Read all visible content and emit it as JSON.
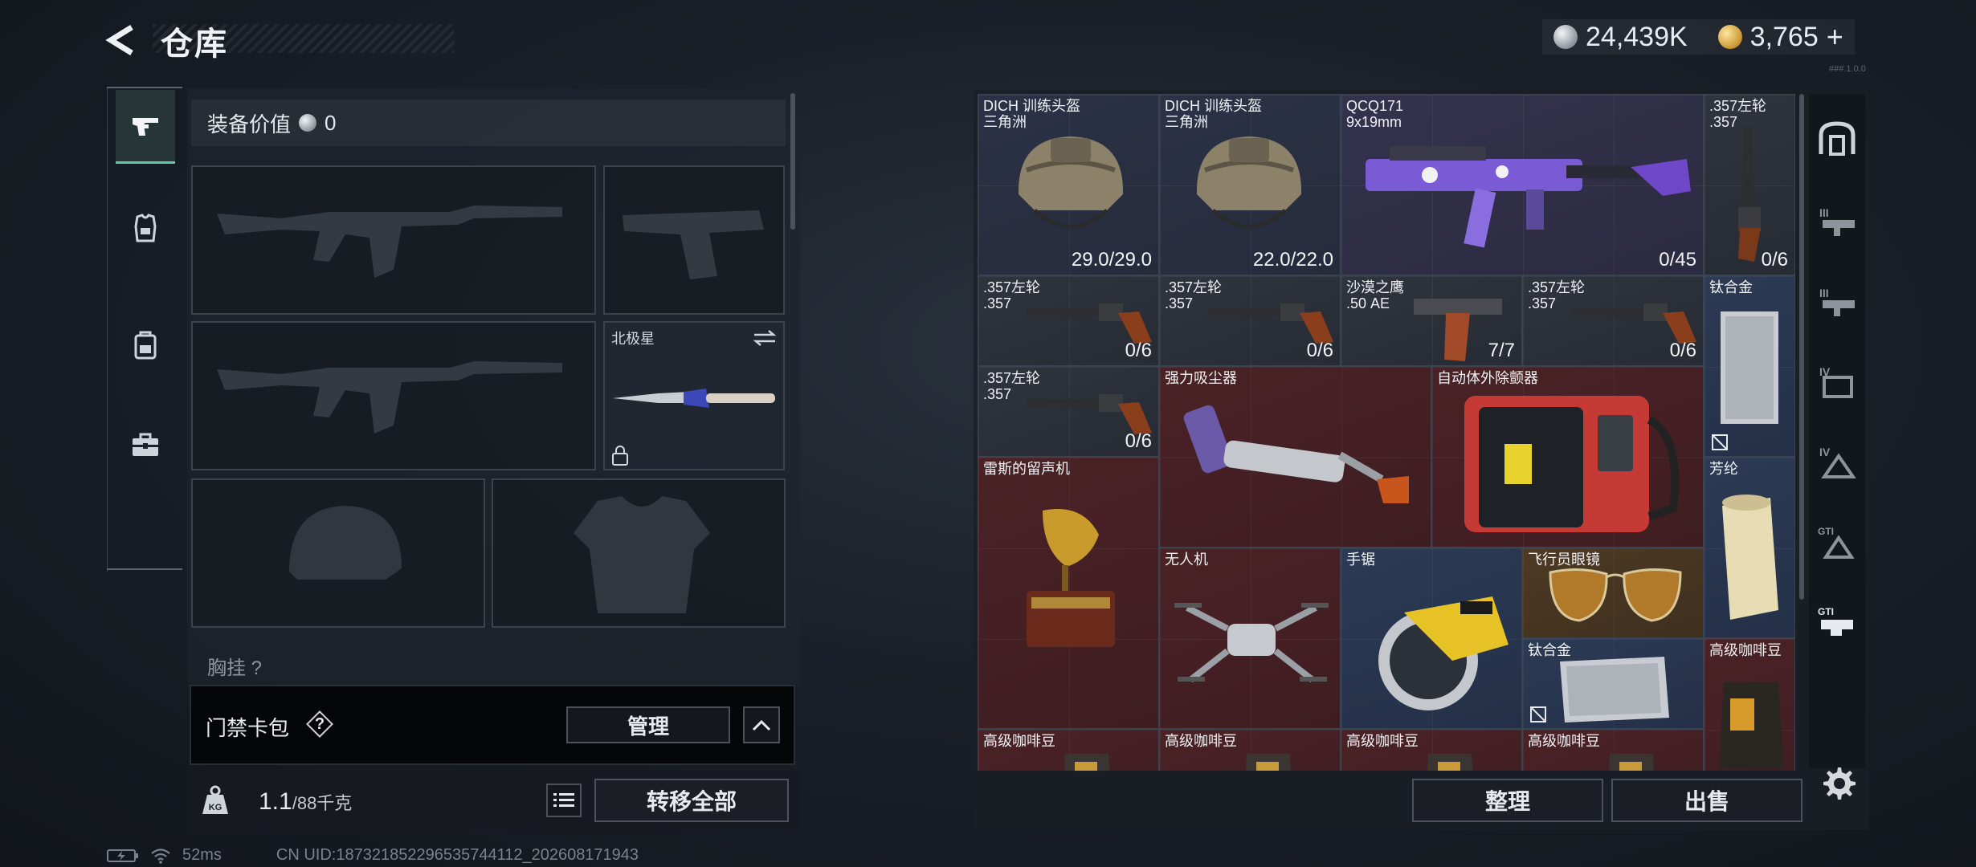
{
  "header": {
    "title": "仓库",
    "currency_a": "24,439K",
    "currency_b": "3,765",
    "currency_b_suffix": "+",
    "version": "###.1.0.0"
  },
  "loadout": {
    "value_label": "装备价值",
    "value": "0",
    "melee_label": "北极星",
    "chest_label": "胸挂",
    "chest_hint": "?",
    "card_bag_label": "门禁卡包",
    "card_bag_help": "?",
    "manage_label": "管理",
    "weight_current": "1.1",
    "weight_max": "/88千克",
    "transfer_label": "转移全部"
  },
  "storage": {
    "items": [
      {
        "name": "DICH 训练头盔\n三角洲",
        "count": "29.0/29.0",
        "tone": "b"
      },
      {
        "name": "DICH 训练头盔\n三角洲",
        "count": "22.0/22.0",
        "tone": "b"
      },
      {
        "name": "QCQ171\n9x19mm",
        "count": "0/45",
        "tone": "p"
      },
      {
        "name": ".357左轮\n.357",
        "count": "0/6",
        "tone": "g"
      },
      {
        "name": ".357左轮\n.357",
        "count": "0/6",
        "tone": "g"
      },
      {
        "name": ".357左轮\n.357",
        "count": "0/6",
        "tone": "g"
      },
      {
        "name": "沙漠之鹰\n.50 AE",
        "count": "7/7",
        "tone": "g"
      },
      {
        "name": ".357左轮\n.357",
        "count": "0/6",
        "tone": "g"
      },
      {
        "name": "钛合金",
        "count": "",
        "tone": "s"
      },
      {
        "name": ".357左轮\n.357",
        "count": "0/6",
        "tone": "g"
      },
      {
        "name": "强力吸尘器",
        "count": "",
        "tone": "r"
      },
      {
        "name": "自动体外除颤器",
        "count": "",
        "tone": "r"
      },
      {
        "name": "雷斯的留声机",
        "count": "",
        "tone": "r"
      },
      {
        "name": "芳纶",
        "count": "",
        "tone": "s"
      },
      {
        "name": "无人机",
        "count": "",
        "tone": "r"
      },
      {
        "name": "手锯",
        "count": "",
        "tone": "s"
      },
      {
        "name": "飞行员眼镜",
        "count": "",
        "tone": "o"
      },
      {
        "name": "钛合金",
        "count": "",
        "tone": "s"
      },
      {
        "name": "高级咖啡豆",
        "count": "",
        "tone": "r"
      },
      {
        "name": "高级咖啡豆",
        "count": "",
        "tone": "r"
      },
      {
        "name": "高级咖啡豆",
        "count": "",
        "tone": "r"
      },
      {
        "name": "高级咖啡豆",
        "count": "",
        "tone": "r"
      },
      {
        "name": "高级咖啡豆",
        "count": "",
        "tone": "r"
      }
    ],
    "sort_label": "整理",
    "sell_label": "出售"
  },
  "status": {
    "ping": "52ms",
    "uid": "CN UID:1873218522965357441​12_202608171943"
  },
  "colors": {
    "accent_green": "#5fc9a0",
    "rare_red": "#4a2226",
    "rare_blue": "#2c3a54",
    "rare_purple": "#34334e",
    "rare_orange": "#4e3a24"
  }
}
